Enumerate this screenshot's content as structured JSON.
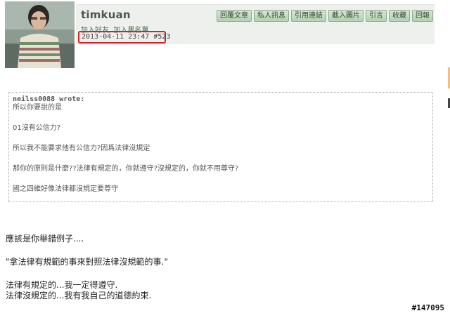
{
  "post": {
    "username": "timkuan",
    "add_friend": "加入好友",
    "add_blacklist": "加入黑名單",
    "datetime": "2013-04-11 23:47",
    "post_number": "#523"
  },
  "actions": [
    {
      "label": "回覆文章"
    },
    {
      "label": "私人訊息"
    },
    {
      "label": "引用連結"
    },
    {
      "label": "截入圖片"
    },
    {
      "label": "引言"
    },
    {
      "label": "收藏"
    },
    {
      "label": "回報"
    }
  ],
  "quote": {
    "author": "neilss0088 wrote:",
    "lines": [
      "所以你要說的是",
      "01沒有公信力?",
      "所以我不能要求他有公信力?因爲法律沒規定",
      "那你的原則是什麼??法律有規定的，你就遵守?沒規定的，你就不用尊守?",
      "國之四維好像法律都沒規定要尊守"
    ]
  },
  "reply": {
    "lines": [
      "應該是你舉錯例子....",
      "\"拿法律有規範的事來對照法律沒規範的事.\"",
      "法律有規定的...我一定得遵守.",
      "法律沒規定的...我有我自己的道德約束."
    ]
  },
  "watermark": "#147095",
  "colors": {
    "meta_highlight": "#e02020",
    "button_bg": "#c7dcc4",
    "header_bg": "#eef0ee"
  }
}
